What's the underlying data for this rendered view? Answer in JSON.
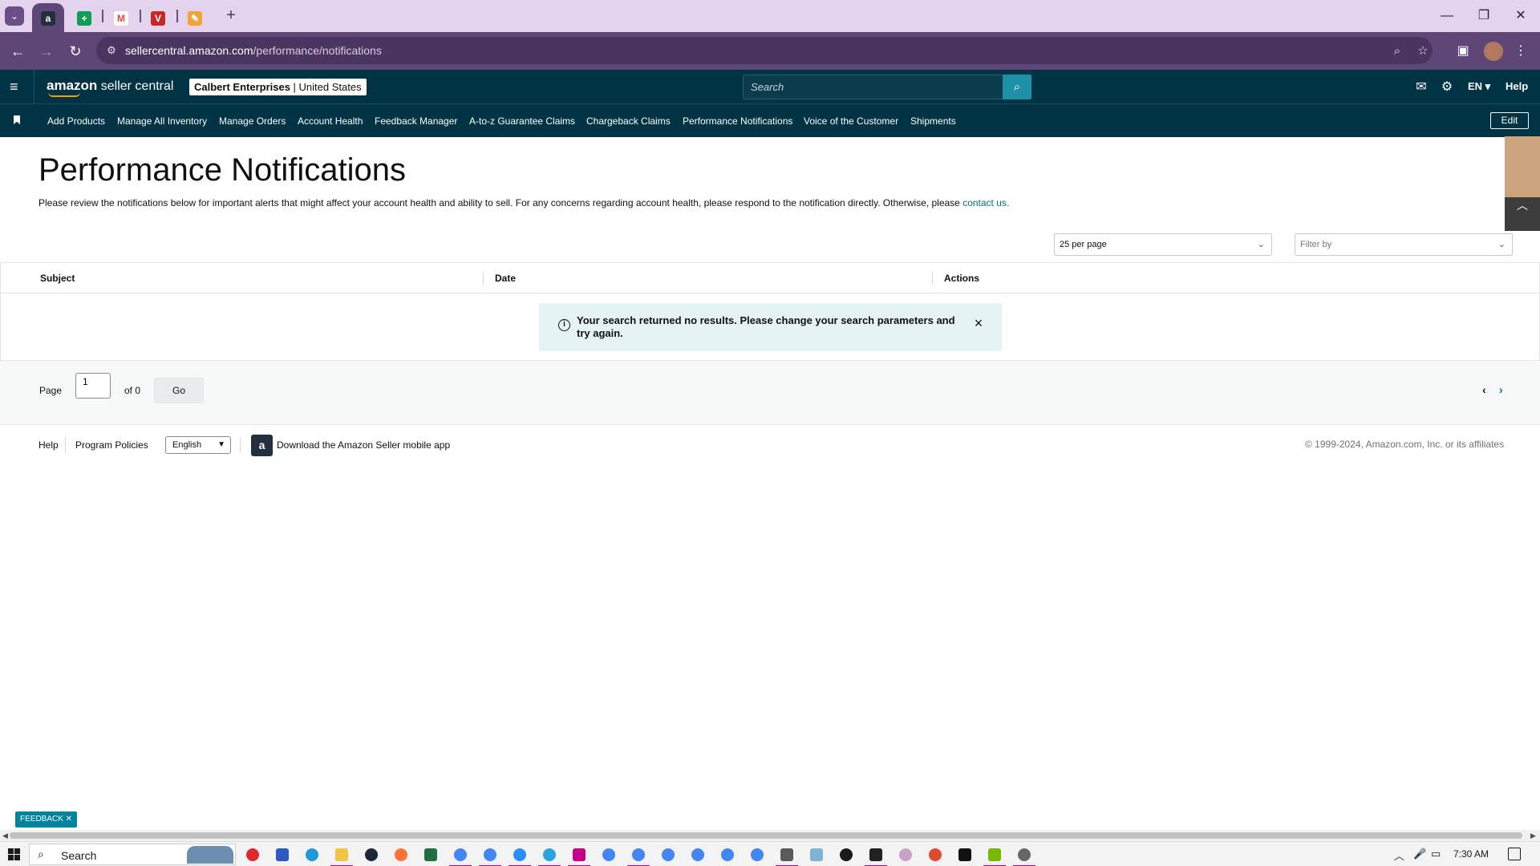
{
  "browser": {
    "tabs": [
      {
        "name": "amazon",
        "icon": "a",
        "color": "#232f3e"
      },
      {
        "name": "sheets",
        "icon": "+",
        "color": "#0f9d58"
      },
      {
        "name": "gmail",
        "icon": "M",
        "color": "#ea4335"
      },
      {
        "name": "vivaldi-like",
        "icon": "V",
        "color": "#c62828"
      },
      {
        "name": "pen",
        "icon": "✎",
        "color": "#f2a33a"
      }
    ],
    "url_host": "sellercentral.amazon.com",
    "url_path": "/performance/notifications"
  },
  "header": {
    "logo_bold": "amazon",
    "logo_rest": " seller central",
    "account_name": "Calbert Enterprises",
    "account_region": "United States",
    "search_placeholder": "Search",
    "language": "EN",
    "help": "Help"
  },
  "bookmarks": {
    "items": [
      "Add Products",
      "Manage All Inventory",
      "Manage Orders",
      "Account Health",
      "Feedback Manager",
      "A-to-z Guarantee Claims",
      "Chargeback Claims",
      "Performance Notifications",
      "Voice of the Customer",
      "Shipments"
    ],
    "edit": "Edit"
  },
  "page": {
    "title": "Performance Notifications",
    "description": "Please review the notifications below for important alerts that might affect your account health and ability to sell. For any concerns regarding account health, please respond to the notification directly. Otherwise, please ",
    "contact_link": "contact us.",
    "per_page": "25 per page",
    "filter_placeholder": "Filter by",
    "columns": [
      "Subject",
      "Date",
      "Actions"
    ],
    "alert": "Your search returned no results. Please change your search parameters and try again.",
    "pager": {
      "page_label": "Page",
      "page_value": "1",
      "of_label": "of 0",
      "go": "Go"
    }
  },
  "footer": {
    "help": "Help",
    "program_policies": "Program Policies",
    "language": "English",
    "app_download": "Download the Amazon Seller mobile app",
    "copyright": "© 1999-2024, Amazon.com, Inc. or its affiliates"
  },
  "feedback_label": "FEEDBACK",
  "taskbar": {
    "search": "Search",
    "time": "7:30 AM"
  }
}
